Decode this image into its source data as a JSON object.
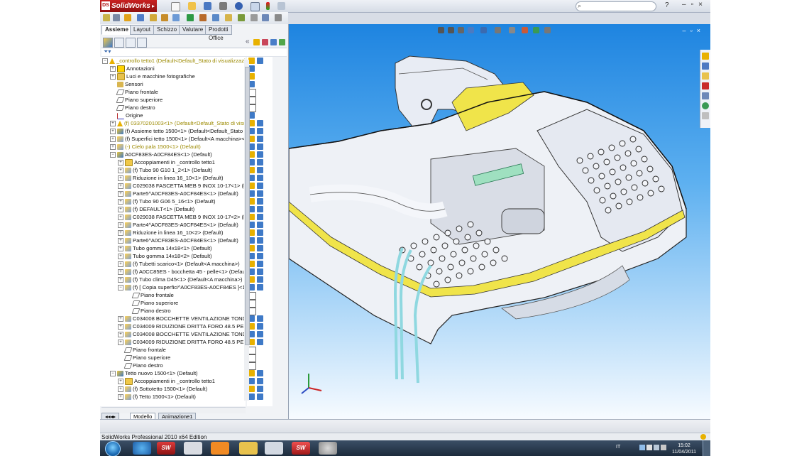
{
  "app": {
    "logo": "SolidWorks",
    "brand_red": "#c41e1e",
    "search_placeholder": "",
    "help_label": "?"
  },
  "left_panel": {
    "tabs": [
      "Assieme",
      "Layout",
      "Schizzo",
      "Valutare",
      "Prodotti Office"
    ],
    "active_tab": "Assieme",
    "model_tabs": [
      "Modello",
      "Animazione1"
    ],
    "active_model_tab": "Modello"
  },
  "tree": [
    {
      "label": "_controllo tetto1  (Default<Default_Stato di visualizzazione-1>)",
      "depth": 0,
      "icon": "warn",
      "expander": "-",
      "color": "yellow"
    },
    {
      "label": "Annotazioni",
      "depth": 1,
      "icon": "annot",
      "expander": "+"
    },
    {
      "label": "Luci e macchine fotografiche",
      "depth": 1,
      "icon": "folder",
      "expander": "+"
    },
    {
      "label": "Sensori",
      "depth": 1,
      "icon": "sensor",
      "expander": ""
    },
    {
      "label": "Piano frontale",
      "depth": 1,
      "icon": "plane",
      "expander": ""
    },
    {
      "label": "Piano superiore",
      "depth": 1,
      "icon": "plane",
      "expander": ""
    },
    {
      "label": "Piano destro",
      "depth": 1,
      "icon": "plane",
      "expander": ""
    },
    {
      "label": "Origine",
      "depth": 1,
      "icon": "origin",
      "expander": ""
    },
    {
      "label": "(f) 03370201003<1> (Default<Default_Stato di visualizzazione-1>)",
      "depth": 1,
      "icon": "warn",
      "expander": "+",
      "color": "yellow"
    },
    {
      "label": "(f) Assieme tetto 1500<1> (Default<Default_Stato di visualizzazione-1>)",
      "depth": 1,
      "icon": "asm",
      "expander": "+"
    },
    {
      "label": "(f) Superfici tetto 1500<1> (Default<A macchina><Default>)",
      "depth": 1,
      "icon": "part",
      "expander": "+"
    },
    {
      "label": "(-) Cielo pala 1500<1> (Default)",
      "depth": 1,
      "icon": "part",
      "expander": "+",
      "color": "yellow"
    },
    {
      "label": "A0CF83ES-A0CF84ES<1> (Default)",
      "depth": 1,
      "icon": "asm",
      "expander": "-"
    },
    {
      "label": "Accoppiamenti in _controllo tetto1",
      "depth": 2,
      "icon": "mate",
      "expander": "+"
    },
    {
      "label": "(f) Tubo 90 G10 1_2<1> (Default)",
      "depth": 2,
      "icon": "part",
      "expander": "+"
    },
    {
      "label": "Riduzione in linea 16_10<1> (Default)",
      "depth": 2,
      "icon": "part",
      "expander": "+"
    },
    {
      "label": "C029038 FASCETTA MEB 9 INOX 10-17<1> (Default)",
      "depth": 2,
      "icon": "part",
      "expander": "+"
    },
    {
      "label": "Parte5^A0CF83ES-A0CF84ES<1> (Default)",
      "depth": 2,
      "icon": "part",
      "expander": "+"
    },
    {
      "label": "(f) Tubo 90 G06 5_16<1> (Default)",
      "depth": 2,
      "icon": "part",
      "expander": "+"
    },
    {
      "label": "(f) DEFAULT<1> (Default)",
      "depth": 2,
      "icon": "part",
      "expander": "+"
    },
    {
      "label": "C029038 FASCETTA MEB 9 INOX 10-17<2> (Default)",
      "depth": 2,
      "icon": "part",
      "expander": "+"
    },
    {
      "label": "Parte4^A0CF83ES-A0CF84ES<1> (Default)",
      "depth": 2,
      "icon": "part",
      "expander": "+"
    },
    {
      "label": "Riduzione in linea 16_10<2> (Default)",
      "depth": 2,
      "icon": "part",
      "expander": "+"
    },
    {
      "label": "Parte6^A0CF83ES-A0CF84ES<1> (Default)",
      "depth": 2,
      "icon": "part",
      "expander": "+"
    },
    {
      "label": "Tubo gomma 14x18<1> (Default)",
      "depth": 2,
      "icon": "part",
      "expander": "+"
    },
    {
      "label": "Tubo gomma 14x18<2> (Default)",
      "depth": 2,
      "icon": "part",
      "expander": "+"
    },
    {
      "label": "(f) Tubetti scarico<1> (Default<A macchina>)",
      "depth": 2,
      "icon": "part",
      "expander": "+"
    },
    {
      "label": "(f) A0CC85ES - bocchetta 45 - pelle<1> (Default)",
      "depth": 2,
      "icon": "part",
      "expander": "+"
    },
    {
      "label": "(f) Tubo clima D45<1> (Default<A macchina>)",
      "depth": 2,
      "icon": "part",
      "expander": "+"
    },
    {
      "label": "(f) [ Copia superfici^A0CF83ES-A0CF84ES ]<1> (Default)",
      "depth": 2,
      "icon": "part",
      "expander": "-"
    },
    {
      "label": "Piano frontale",
      "depth": 3,
      "icon": "plane",
      "expander": ""
    },
    {
      "label": "Piano superiore",
      "depth": 3,
      "icon": "plane",
      "expander": ""
    },
    {
      "label": "Piano destro",
      "depth": 3,
      "icon": "plane",
      "expander": ""
    },
    {
      "label": "C034008 BOCCHETTE VENTILAZIONE TONDE Ø76<1>",
      "depth": 2,
      "icon": "part",
      "expander": "+"
    },
    {
      "label": "C034009 RIDUZIONE DRITTA FORO 48.5 PER BOCCHETTE<1>",
      "depth": 2,
      "icon": "part",
      "expander": "+"
    },
    {
      "label": "C034008 BOCCHETTE VENTILAZIONE TONDE Ø76<2>",
      "depth": 2,
      "icon": "part",
      "expander": "+"
    },
    {
      "label": "C034009 RIDUZIONE DRITTA FORO 48.5 PER BOCCHETTE<2>",
      "depth": 2,
      "icon": "part",
      "expander": "+"
    },
    {
      "label": "Piano frontale",
      "depth": 2,
      "icon": "plane",
      "expander": ""
    },
    {
      "label": "Piano superiore",
      "depth": 2,
      "icon": "plane",
      "expander": ""
    },
    {
      "label": "Piano destro",
      "depth": 2,
      "icon": "plane",
      "expander": ""
    },
    {
      "label": "Tetto nuovo 1500<1> (Default)",
      "depth": 1,
      "icon": "asm",
      "expander": "-"
    },
    {
      "label": "Accoppiamenti in _controllo tetto1",
      "depth": 2,
      "icon": "mate",
      "expander": "+"
    },
    {
      "label": "(f) Sottotetto 1500<1> (Default)",
      "depth": 2,
      "icon": "part",
      "expander": "+"
    },
    {
      "label": "(f) Tetto 1500<1> (Default)",
      "depth": 2,
      "icon": "part",
      "expander": "+"
    }
  ],
  "statusbar": {
    "text": "SolidWorks Professional 2010 x64 Edition"
  },
  "taskbar": {
    "language": "IT",
    "time": "15:02",
    "date": "11/04/2011",
    "sw_label": "SW"
  },
  "viewport": {
    "background_top": "#1e84e0",
    "background_bottom": "#f7fbff",
    "model": "roof assembly with ventilation nozzles, pipes and yellow edge band"
  },
  "colors": {
    "accent_yellow": "#f0e44a",
    "pipe_cyan": "#8fd8e0"
  }
}
